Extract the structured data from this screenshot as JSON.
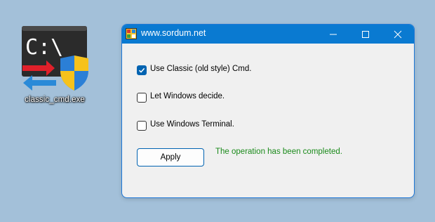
{
  "desktop": {
    "icon_name": "cmd-shield-icon",
    "icon_label": "classic_cmd.exe",
    "icon_glyph_text": "C:\\"
  },
  "window": {
    "title": "www.sordum.net",
    "accent_color": "#0a7ad1",
    "options": [
      {
        "label": "Use Classic (old style) Cmd.",
        "checked": true
      },
      {
        "label": "Let Windows decide.",
        "checked": false
      },
      {
        "label": "Use Windows Terminal.",
        "checked": false
      }
    ],
    "apply_label": "Apply",
    "status_text": "The operation has been completed.",
    "status_color": "#1a8a1a"
  }
}
